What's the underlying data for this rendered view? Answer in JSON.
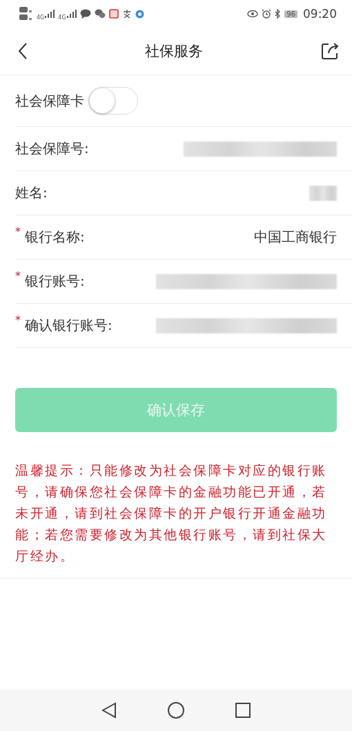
{
  "status_bar": {
    "signals": [
      "4G",
      "4G"
    ],
    "battery": "96",
    "time": "09:20"
  },
  "header": {
    "title": "社保服务"
  },
  "form": [
    {
      "kind": "toggle",
      "label": "社会保障卡",
      "on": false
    },
    {
      "kind": "hidden",
      "label": "社会保障号:"
    },
    {
      "kind": "hidden",
      "label": "姓名:"
    },
    {
      "kind": "text",
      "required_mark": "*",
      "label": "银行名称:",
      "value": "中国工商银行"
    },
    {
      "kind": "hidden",
      "required_mark": "*",
      "label": "银行账号:"
    },
    {
      "kind": "hidden",
      "required_mark": "*",
      "label": "确认银行账号:"
    }
  ],
  "save_button": {
    "label": "确认保存",
    "disabled": true
  },
  "notice": "温馨提示：只能修改为社会保障卡对应的银行账号，请确保您社会保障卡的金融功能已开通，若未开通，请到社会保障卡的开户银行开通金融功能；若您需要修改为其他银行账号，请到社保大厅经办。"
}
